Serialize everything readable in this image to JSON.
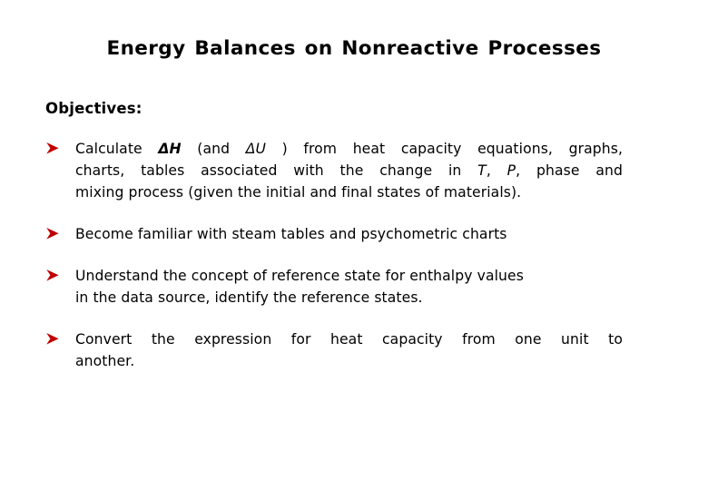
{
  "slide": {
    "title": "Energy Balances on Nonreactive Processes",
    "objectives_heading": "Objectives:",
    "bullet_marker_icon": "red-arrow-bullet-icon",
    "bullet_color": "#C00000",
    "text_color": "#000000",
    "background_color": "#FFFFFF",
    "bullets": [
      {
        "id": "bullet-calculate-enthalpy",
        "lines": [
          {
            "segments": [
              {
                "text": "Calculate ",
                "style": "normal"
              },
              {
                "text": "ΔH",
                "style": "bold-italic"
              },
              {
                "text": " (and ",
                "style": "normal"
              },
              {
                "text": "ΔU",
                "style": "italic"
              },
              {
                "text": " ) from heat capacity equations, graphs,",
                "style": "normal"
              }
            ],
            "justify": true
          },
          {
            "segments": [
              {
                "text": "charts, tables associated with the change in ",
                "style": "normal"
              },
              {
                "text": "T",
                "style": "italic"
              },
              {
                "text": ", ",
                "style": "normal"
              },
              {
                "text": "P",
                "style": "italic"
              },
              {
                "text": ", phase and",
                "style": "normal"
              }
            ],
            "justify": true
          },
          {
            "segments": [
              {
                "text": "mixing process (given the initial and final states of materials).",
                "style": "normal"
              }
            ],
            "justify": false
          }
        ]
      },
      {
        "id": "bullet-steam-tables",
        "lines": [
          {
            "segments": [
              {
                "text": "Become familiar with steam tables and psychometric charts",
                "style": "normal"
              }
            ],
            "justify": false
          }
        ]
      },
      {
        "id": "bullet-reference-state",
        "lines": [
          {
            "segments": [
              {
                "text": "Understand the concept of reference state for enthalpy values",
                "style": "normal"
              }
            ],
            "justify": false
          },
          {
            "segments": [
              {
                "text": "in the data source, identify the reference states.",
                "style": "normal"
              }
            ],
            "justify": false
          }
        ]
      },
      {
        "id": "bullet-unit-conversion",
        "lines": [
          {
            "segments": [
              {
                "text": "Convert the expression for heat capacity from one unit to",
                "style": "normal"
              }
            ],
            "justify": true
          },
          {
            "segments": [
              {
                "text": "another.",
                "style": "normal"
              }
            ],
            "justify": false
          }
        ]
      }
    ]
  }
}
